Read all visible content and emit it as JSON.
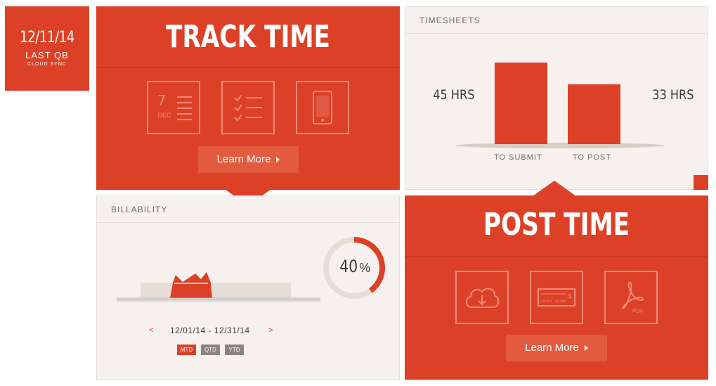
{
  "sync": {
    "date": "12/11/14",
    "line1": "LAST QB",
    "line2": "CLOUD SYNC"
  },
  "track": {
    "title": "TRACK TIME",
    "calendar_day": "7",
    "calendar_month": "DEC",
    "learn_more": "Learn More",
    "icons": [
      "calendar-list-icon",
      "checklist-icon",
      "phone-icon"
    ]
  },
  "timesheets": {
    "heading": "TIMESHEETS",
    "left_value": "45 HRS",
    "right_value": "33 HRS",
    "bar_labels": [
      "TO SUBMIT",
      "TO POST"
    ]
  },
  "chart_data": {
    "type": "bar",
    "categories": [
      "TO SUBMIT",
      "TO POST"
    ],
    "values": [
      45,
      33
    ]
  },
  "billability": {
    "heading": "BILLABILITY",
    "percent_number": "40",
    "percent_sign": "%",
    "percent_value": 0.4,
    "date_range": "12/01/14 - 12/31/14",
    "prev": "<",
    "next": ">",
    "tabs": [
      "MTD",
      "QTD",
      "YTD"
    ]
  },
  "post": {
    "title": "POST TIME",
    "learn_more": "Learn More",
    "check_text": "10101 00100",
    "check_symbol": "$",
    "pdf_label": "PDF",
    "icons": [
      "cloud-download-icon",
      "check-icon",
      "pdf-icon"
    ]
  },
  "colors": {
    "accent": "#dc4127",
    "light_bg": "#f6f1ee",
    "tag_gray": "#8a8480"
  }
}
